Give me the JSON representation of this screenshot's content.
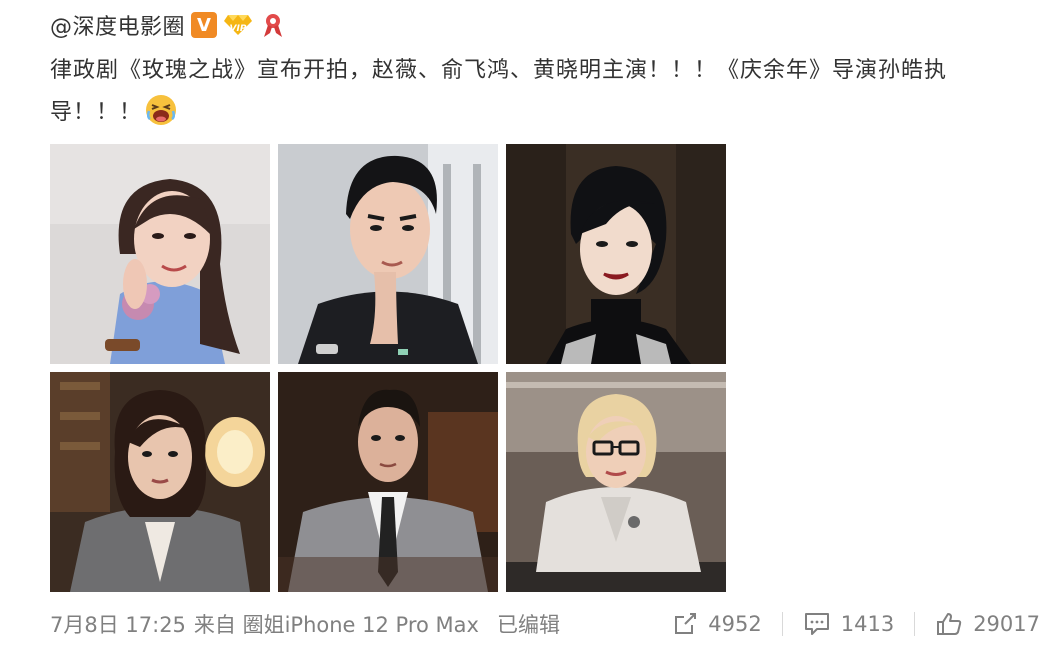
{
  "post": {
    "username": "@深度电影圈",
    "text": "律政剧《玫瑰之战》宣布开拍，赵薇、俞飞鸿、黄晓明主演！！！《庆余年》导演孙皓执导！！！",
    "timestamp": "7月8日 17:25",
    "source": "来自 圈姐iPhone 12 Pro Max",
    "edited": "已编辑",
    "badges": [
      "verified-v-icon",
      "vip-diamond-icon",
      "ribbon-badge-icon"
    ],
    "emoji": "laughing-crying-emoji"
  },
  "actions": {
    "repost_count": "4952",
    "comment_count": "1413",
    "like_count": "29017"
  },
  "colors": {
    "verified_orange": "#f08a24",
    "text": "#333333",
    "meta_gray": "#808080"
  },
  "photos": [
    {
      "name": "photo-woman-blue-shirt"
    },
    {
      "name": "photo-man-black-shirt"
    },
    {
      "name": "photo-woman-black-turtleneck"
    },
    {
      "name": "photo-woman-gray-suit"
    },
    {
      "name": "photo-man-gray-suit"
    },
    {
      "name": "photo-woman-white-jacket-glasses"
    }
  ]
}
